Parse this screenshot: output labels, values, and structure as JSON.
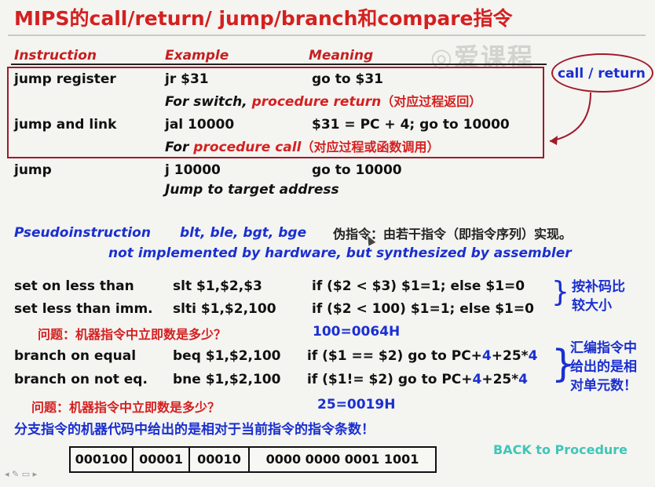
{
  "title": "MIPS的call/return/ jump/branch和compare指令",
  "watermark": "爱课程",
  "headers": {
    "instruction": "Instruction",
    "example": "Example",
    "meaning": "Meaning"
  },
  "rows": [
    {
      "instr": "jump register",
      "example": "jr $31",
      "meaning": "go to $31",
      "note_prefix": "For switch, ",
      "note_red": "procedure return",
      "note_cn": "（对应过程返回）"
    },
    {
      "instr": "jump and link",
      "example": "jal 10000",
      "meaning": "$31 = PC + 4; go to 10000",
      "note_prefix": "For ",
      "note_red": "procedure call",
      "note_cn": "（对应过程或函数调用）"
    },
    {
      "instr": "jump",
      "example": "j 10000",
      "meaning": "go to 10000",
      "note_plain": "Jump to target address"
    }
  ],
  "call_return_label": "call / return",
  "pseudo": {
    "label": "Pseudoinstruction",
    "list": "blt, ble, bgt, bge",
    "cn": "伪指令：由若干指令（即指令序列）实现。",
    "line2": "not implemented by hardware, but synthesized by assembler"
  },
  "compare": [
    {
      "instr": "set on less than",
      "example": "slt $1,$2,$3",
      "meaning": "if ($2 < $3) $1=1; else $1=0"
    },
    {
      "instr": "set less than imm.",
      "example": "slti $1,$2,100",
      "meaning": "if ($2 < 100) $1=1; else $1=0"
    }
  ],
  "compare_side": [
    "按补码比",
    "较大小"
  ],
  "question1": {
    "text": "问题：机器指令中立即数是多少？",
    "answer": "100=0064H"
  },
  "branches": [
    {
      "instr": "branch on equal",
      "example": "beq $1,$2,100",
      "meaning_a": "if ($1 == $2) go to PC+",
      "four": "4",
      "meaning_b": "+25*",
      "four2": "4"
    },
    {
      "instr": "branch on not eq.",
      "example": "bne $1,$2,100",
      "meaning_a": "if ($1!= $2) go to PC+",
      "four": "4",
      "meaning_b": "+25*",
      "four2": "4"
    }
  ],
  "branch_side": [
    "汇编指令中",
    "给出的是相",
    "对单元数！"
  ],
  "question2": {
    "text": "问题：机器指令中立即数是多少？",
    "answer": "25=0019H"
  },
  "summary": "分支指令的机器代码中给出的是相对于当前指令的指令条数！",
  "machine_code": [
    "000100",
    "00001",
    "00010",
    "0000 0000 0001 1001"
  ],
  "back_link": "BACK to Procedure",
  "colors": {
    "title_red": "#d42020",
    "blue": "#1a2fd0",
    "box": "#a01a2a",
    "teal": "#3fc6b6"
  }
}
